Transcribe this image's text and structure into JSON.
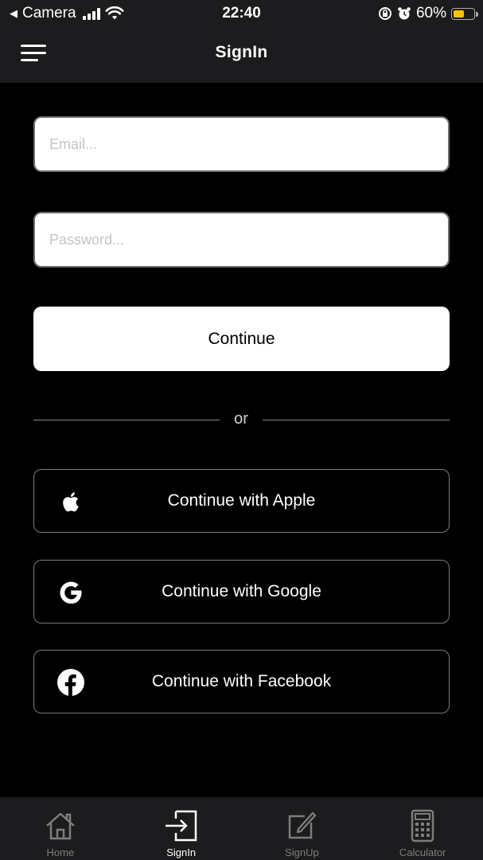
{
  "status_bar": {
    "back_app": "Camera",
    "time": "22:40",
    "battery_percent": "60%",
    "battery_level": 0.6,
    "battery_color": "#f5c400",
    "icons": [
      "back-arrow-icon",
      "signal-icon",
      "wifi-icon",
      "orientation-lock-icon",
      "alarm-icon",
      "battery-icon"
    ]
  },
  "header": {
    "title": "SignIn",
    "menu_icon": "hamburger-menu-icon"
  },
  "form": {
    "email": {
      "placeholder": "Email...",
      "value": ""
    },
    "password": {
      "placeholder": "Password...",
      "value": ""
    },
    "continue_label": "Continue",
    "divider_text": "or"
  },
  "social": [
    {
      "label": "Continue with Apple",
      "icon": "apple-icon"
    },
    {
      "label": "Continue with Google",
      "icon": "google-icon"
    },
    {
      "label": "Continue with Facebook",
      "icon": "facebook-icon"
    }
  ],
  "tab_bar": {
    "tabs": [
      {
        "label": "Home",
        "icon": "home-icon",
        "active": false
      },
      {
        "label": "SignIn",
        "icon": "sign-in-icon",
        "active": true
      },
      {
        "label": "SignUp",
        "icon": "edit-icon",
        "active": false
      },
      {
        "label": "Calculator",
        "icon": "calculator-icon",
        "active": false
      }
    ]
  },
  "colors": {
    "background": "#000000",
    "bar_background": "#1c1c1e",
    "button_background": "#ffffff",
    "inactive_tab": "#7d7d7d"
  }
}
